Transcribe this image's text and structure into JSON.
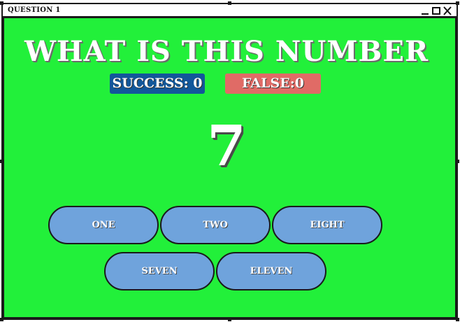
{
  "window": {
    "title": "QUESTION 1",
    "controls": {
      "minimize": "minimize-icon",
      "maximize": "maximize-icon",
      "close": "close-icon"
    }
  },
  "game": {
    "heading": "WHAT IS THIS NUMBER",
    "success_label": "SUCCESS: 0",
    "false_label": "FALSE:0",
    "number": "7",
    "answers": [
      "ONE",
      "TWO",
      "EIGHT",
      "SEVEN",
      "ELEVEN"
    ]
  },
  "colors": {
    "background": "#22f03a",
    "success_badge": "#12579a",
    "false_badge": "#e06b66",
    "answer_button": "#6fa3dc"
  }
}
